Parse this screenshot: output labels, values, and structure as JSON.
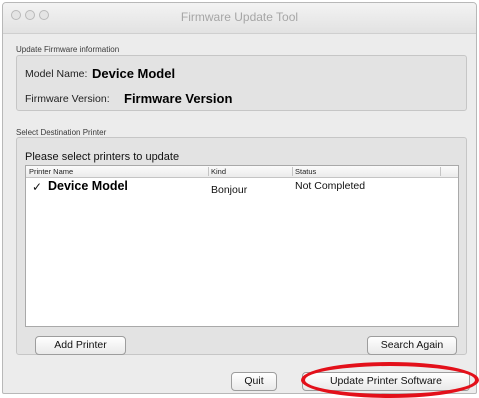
{
  "window": {
    "title": "Firmware Update Tool"
  },
  "firmware_info": {
    "group_title": "Update Firmware information",
    "model_label": "Model Name:",
    "model_value": "Device Model",
    "version_label": "Firmware Version:",
    "version_value": "Firmware Version"
  },
  "destination": {
    "group_title": "Select Destination Printer",
    "prompt": "Please select printers to update",
    "columns": [
      "Printer Name",
      "Kind",
      "Status"
    ],
    "rows": [
      {
        "checked": "✓",
        "name": "Device Model",
        "kind": "Bonjour",
        "status": "Not Completed"
      }
    ],
    "add_button": "Add Printer",
    "search_button": "Search Again"
  },
  "footer": {
    "quit_button": "Quit",
    "update_button": "Update Printer Software"
  },
  "colors": {
    "highlight_ring": "#e3101a",
    "window_bg": "#ececec"
  }
}
